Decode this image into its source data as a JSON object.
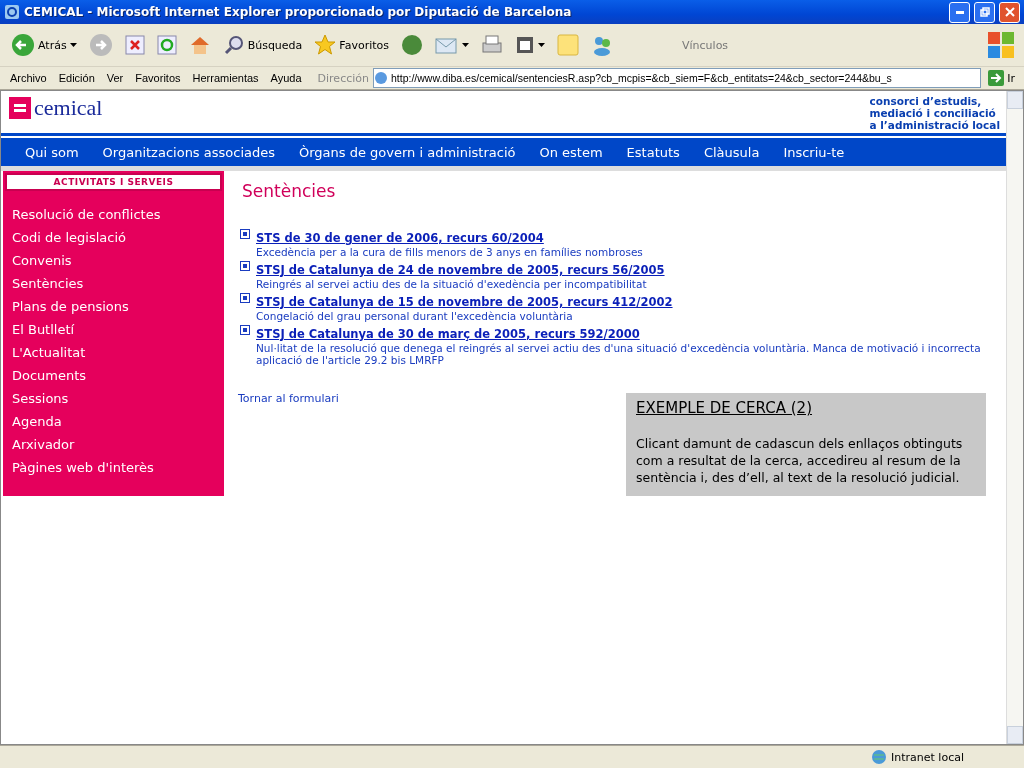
{
  "window": {
    "title": "CEMICAL - Microsoft Internet Explorer proporcionado por Diputació de Barcelona"
  },
  "toolbar": {
    "back": "Atrás",
    "search": "Búsqueda",
    "favorites": "Favoritos",
    "links": "Vínculos"
  },
  "menu": [
    "Archivo",
    "Edición",
    "Ver",
    "Favoritos",
    "Herramientas",
    "Ayuda"
  ],
  "address": {
    "label": "Dirección",
    "value": "http://www.diba.es/cemical/sentenciesR.asp?cb_mcpis=&cb_siem=F&cb_entitats=24&cb_sector=244&bu_s",
    "go": "Ir"
  },
  "header": {
    "logo": "cemical",
    "tagline": [
      "consorci d’estudis,",
      "mediació i conciliació",
      "a l’administració local"
    ]
  },
  "nav": [
    "Qui som",
    "Organitzacions associades",
    "Òrgans de govern i administració",
    "On estem",
    "Estatuts",
    "Clàusula",
    "Inscriu-te"
  ],
  "sidebar": {
    "heading": "ACTIVITATS I SERVEIS",
    "items": [
      "Resolució de conflictes",
      "Codi de legislació",
      "Convenis",
      "Sentències",
      "Plans de pensions",
      "El Butlletí",
      "L'Actualitat",
      "Documents",
      "Sessions",
      "Agenda",
      "Arxivador",
      "Pàgines web d'interès"
    ]
  },
  "page_title": "Sentències",
  "results": [
    {
      "title": "STS de 30 de gener de 2006, recurs 60/2004",
      "description": "Excedència per a la cura de fills menors de 3 anys en famílies nombroses"
    },
    {
      "title": "STSJ de Catalunya de 24 de novembre de 2005, recurs 56/2005",
      "description": "Reingrés al servei actiu des de la situació d'exedència per incompatibilitat"
    },
    {
      "title": "STSJ de Catalunya de 15 de novembre de 2005, recurs 412/2002",
      "description": "Congelació del grau personal durant l'excedència voluntària"
    },
    {
      "title": "STSJ de Catalunya de 30 de març de 2005, recurs 592/2000",
      "description": "Nul·litat de la resolució que denega el reingrés al servei actiu des d'una situació d'excedència voluntària. Manca de motivació i incorrecta aplicació de l'article 29.2 bis LMRFP"
    }
  ],
  "back_link": "Tornar al formulari",
  "note": {
    "title": "EXEMPLE DE CERCA (2)",
    "text": "Clicant damunt de cadascun dels enllaços obtinguts com a resultat de la cerca, accedireu al resum de la sentència i, des d’ell, al text de la resolució judicial."
  },
  "status_bar": {
    "zone": "Intranet local"
  }
}
